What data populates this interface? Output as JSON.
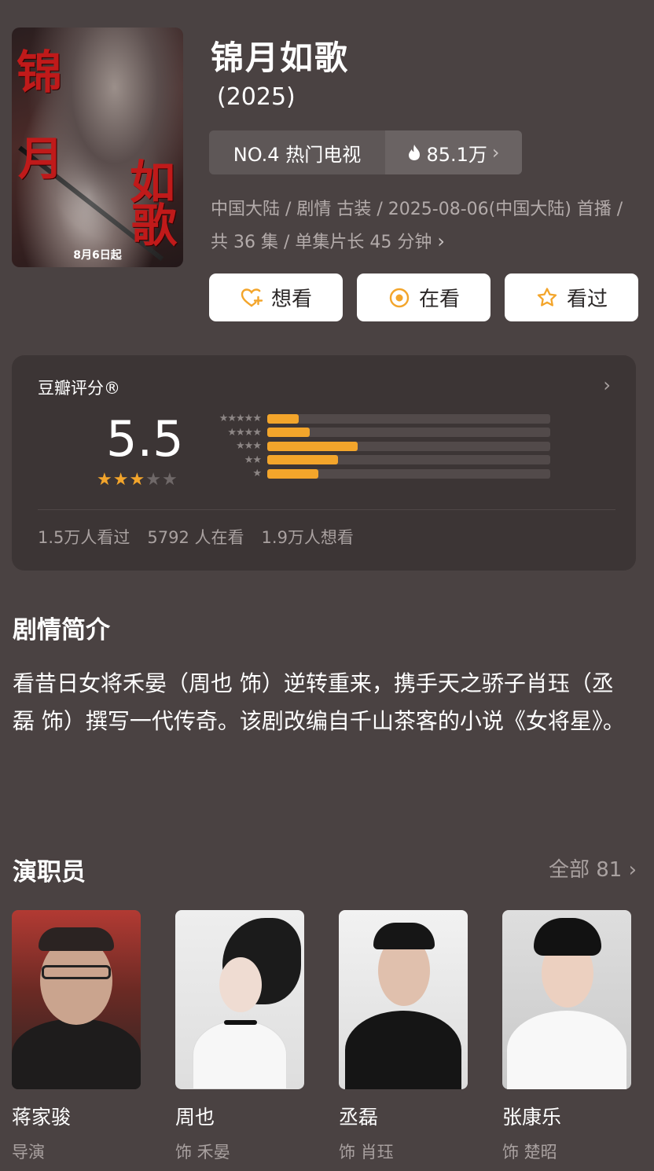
{
  "header": {
    "title": "锦月如歌",
    "year": "(2025)",
    "poster": {
      "char_1": "锦",
      "char_2": "月",
      "char_3": "如",
      "char_4": "歌",
      "date": "8月6日起"
    },
    "rank": {
      "label": "NO.4 热门电视",
      "heat": "85.1万"
    },
    "meta_line": "中国大陆 / 剧情 古装 / 2025-08-06(中国大陆) 首播 / 共 36 集 / 单集片长 45 分钟",
    "meta_chevron": "›"
  },
  "actions": {
    "want": "想看",
    "watching": "在看",
    "watched": "看过"
  },
  "rating": {
    "label": "豆瓣评分®",
    "score": "5.5",
    "score_stars": 3,
    "distribution": [
      {
        "stars": "★★★★★",
        "fraction": 0.11
      },
      {
        "stars": "★★★★",
        "fraction": 0.15
      },
      {
        "stars": "★★★",
        "fraction": 0.32
      },
      {
        "stars": "★★",
        "fraction": 0.25
      },
      {
        "stars": "★",
        "fraction": 0.18
      }
    ],
    "watched": "1.5万人看过",
    "watching": "5792 人在看",
    "want": "1.9万人想看"
  },
  "synopsis": {
    "title": "剧情简介",
    "text": "看昔日女将禾晏（周也 饰）逆转重来，携手天之骄子肖珏（丞磊 饰）撰写一代传奇。该剧改编自千山茶客的小说《女将星》。"
  },
  "cast": {
    "title": "演职员",
    "more": "全部 81",
    "people": [
      {
        "name": "蒋家骏",
        "role": "导演"
      },
      {
        "name": "周也",
        "role": "饰 禾晏"
      },
      {
        "name": "丞磊",
        "role": "饰 肖珏"
      },
      {
        "name": "张康乐",
        "role": "饰 楚昭"
      }
    ]
  },
  "colors": {
    "background": "#4a4242",
    "card": "#3c3535",
    "accent": "#f3a52b",
    "muted_text": "#a9a1a0"
  }
}
